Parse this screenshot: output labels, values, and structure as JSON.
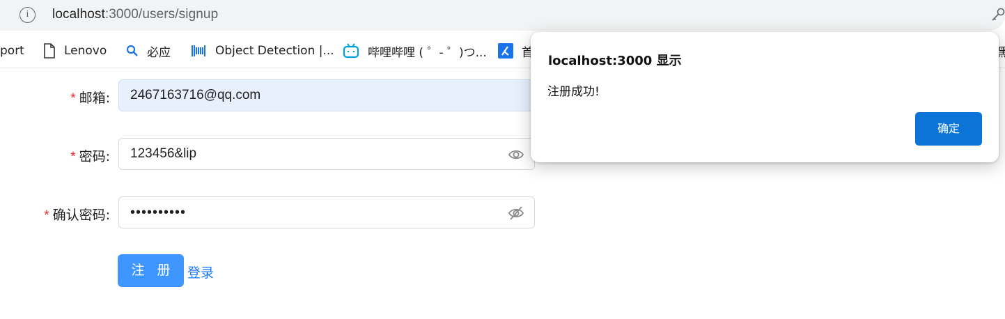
{
  "browser": {
    "url_host": "localhost",
    "url_path": ":3000/users/signup"
  },
  "bookmarks": [
    {
      "label": "port",
      "icon": "none"
    },
    {
      "label": "Lenovo",
      "icon": "document-icon"
    },
    {
      "label": "必应",
      "icon": "search-icon"
    },
    {
      "label": "Object Detection |...",
      "icon": "barcode-icon"
    },
    {
      "label": "哔哩哔哩 ( ゜- ゜)つ...",
      "icon": "bilibili-icon"
    },
    {
      "label": "首",
      "icon": "bookmark-app-icon"
    },
    {
      "label": "黑",
      "icon": "none"
    }
  ],
  "form": {
    "email": {
      "label": "邮箱:",
      "value": "2467163716@qq.com"
    },
    "password": {
      "label": "密码:",
      "value": "123456&lip"
    },
    "confirm": {
      "label": "确认密码:",
      "value": "••••••••••"
    },
    "required_mark": "*",
    "submit_label": "注 册",
    "login_link": "登录"
  },
  "dialog": {
    "title": "localhost:3000 显示",
    "message": "注册成功!",
    "ok_label": "确定"
  },
  "colors": {
    "primary_button": "#4096ff",
    "link": "#1677ff",
    "required": "#f5222d",
    "dialog_button": "#0c74d6"
  }
}
